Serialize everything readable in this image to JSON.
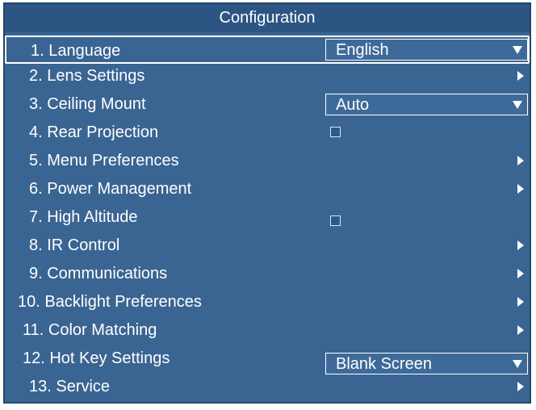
{
  "title": "Configuration",
  "items": [
    {
      "label": "1. Language",
      "control": "dropdown",
      "value": "English",
      "selected": true
    },
    {
      "label": "2. Lens Settings",
      "control": "submenu"
    },
    {
      "label": "3. Ceiling Mount",
      "control": "dropdown",
      "value": "Auto"
    },
    {
      "label": "4. Rear Projection",
      "control": "checkbox",
      "checked": false
    },
    {
      "label": "5. Menu Preferences",
      "control": "submenu"
    },
    {
      "label": "6. Power Management",
      "control": "submenu"
    },
    {
      "label": "7. High Altitude",
      "control": "checkbox",
      "checked": false
    },
    {
      "label": "8. IR Control",
      "control": "submenu"
    },
    {
      "label": "9. Communications",
      "control": "submenu"
    },
    {
      "label": "10. Backlight Preferences",
      "control": "submenu"
    },
    {
      "label": "11. Color Matching",
      "control": "submenu"
    },
    {
      "label": "12. Hot Key Settings",
      "control": "dropdown",
      "value": "Blank Screen"
    },
    {
      "label": "13. Service",
      "control": "submenu"
    }
  ],
  "colors": {
    "panel": "#3a6593",
    "title_bar": "#2c5583",
    "text": "#ffffff"
  }
}
